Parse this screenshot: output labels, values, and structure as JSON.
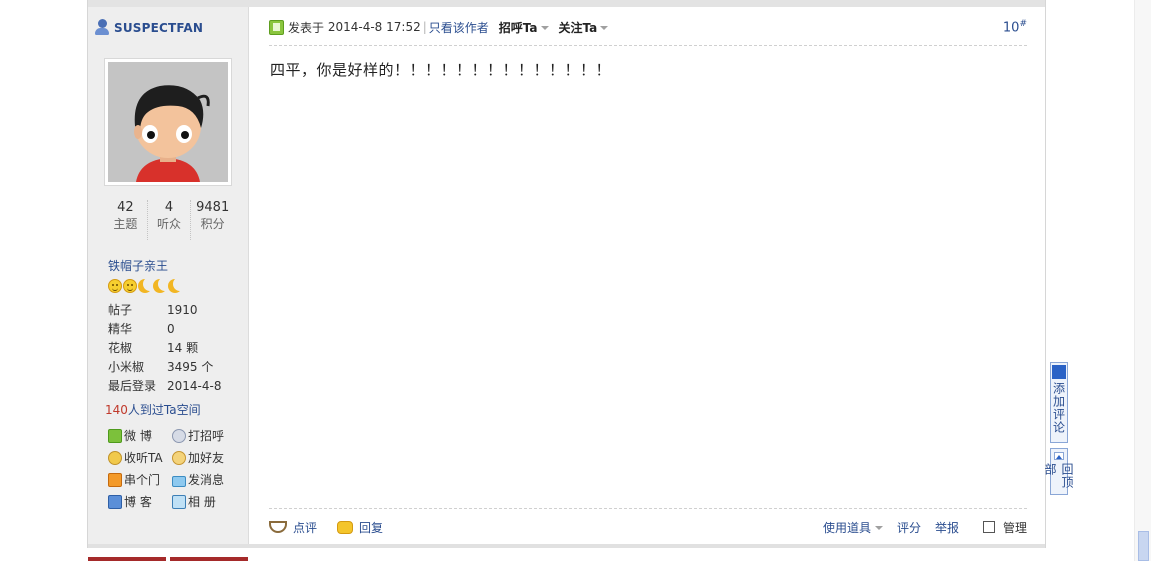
{
  "user": {
    "name": "SUSPECTFAN",
    "stats": [
      {
        "value": "42",
        "label": "主题"
      },
      {
        "value": "4",
        "label": "听众"
      },
      {
        "value": "9481",
        "label": "积分"
      }
    ],
    "rank": "铁帽子亲王",
    "medals": [
      "sun",
      "sun",
      "moon",
      "moon",
      "moon"
    ],
    "info": [
      {
        "key": "帖子",
        "value": "1910"
      },
      {
        "key": "精华",
        "value": "0"
      },
      {
        "key": "花椒",
        "value": "14 颗"
      },
      {
        "key": "小米椒",
        "value": "3495 个"
      },
      {
        "key": "最后登录",
        "value": "2014-4-8"
      }
    ],
    "visits_count": "140",
    "visits_text": "人到过Ta空间",
    "actions": {
      "weibo": "微 博",
      "greet": "打招呼",
      "follow": "收听TA",
      "add_friend": "加好友",
      "visit": "串个门",
      "message": "发消息",
      "blog": "博 客",
      "album": "相 册"
    }
  },
  "post": {
    "posted_label": "发表于",
    "posted_time": "2014-4-8 17:52",
    "separator": "|",
    "only_author": "只看该作者",
    "greet_ta": "招呼Ta",
    "follow_ta": "关注Ta",
    "floor": "10",
    "floor_mark": "#",
    "message": "四平，你是好样的！！！！！！！！！！！！！！"
  },
  "footer": {
    "comment": "点评",
    "reply": "回复",
    "tools": "使用道具",
    "rate": "评分",
    "report": "举报",
    "manage": "管理"
  },
  "float": {
    "add_comment": "添加评论",
    "back_top": "回顶部"
  },
  "colors": {
    "link": "#2a4d8f",
    "sidebar_bg": "#eeeeee",
    "visits_number": "#c0392b"
  }
}
